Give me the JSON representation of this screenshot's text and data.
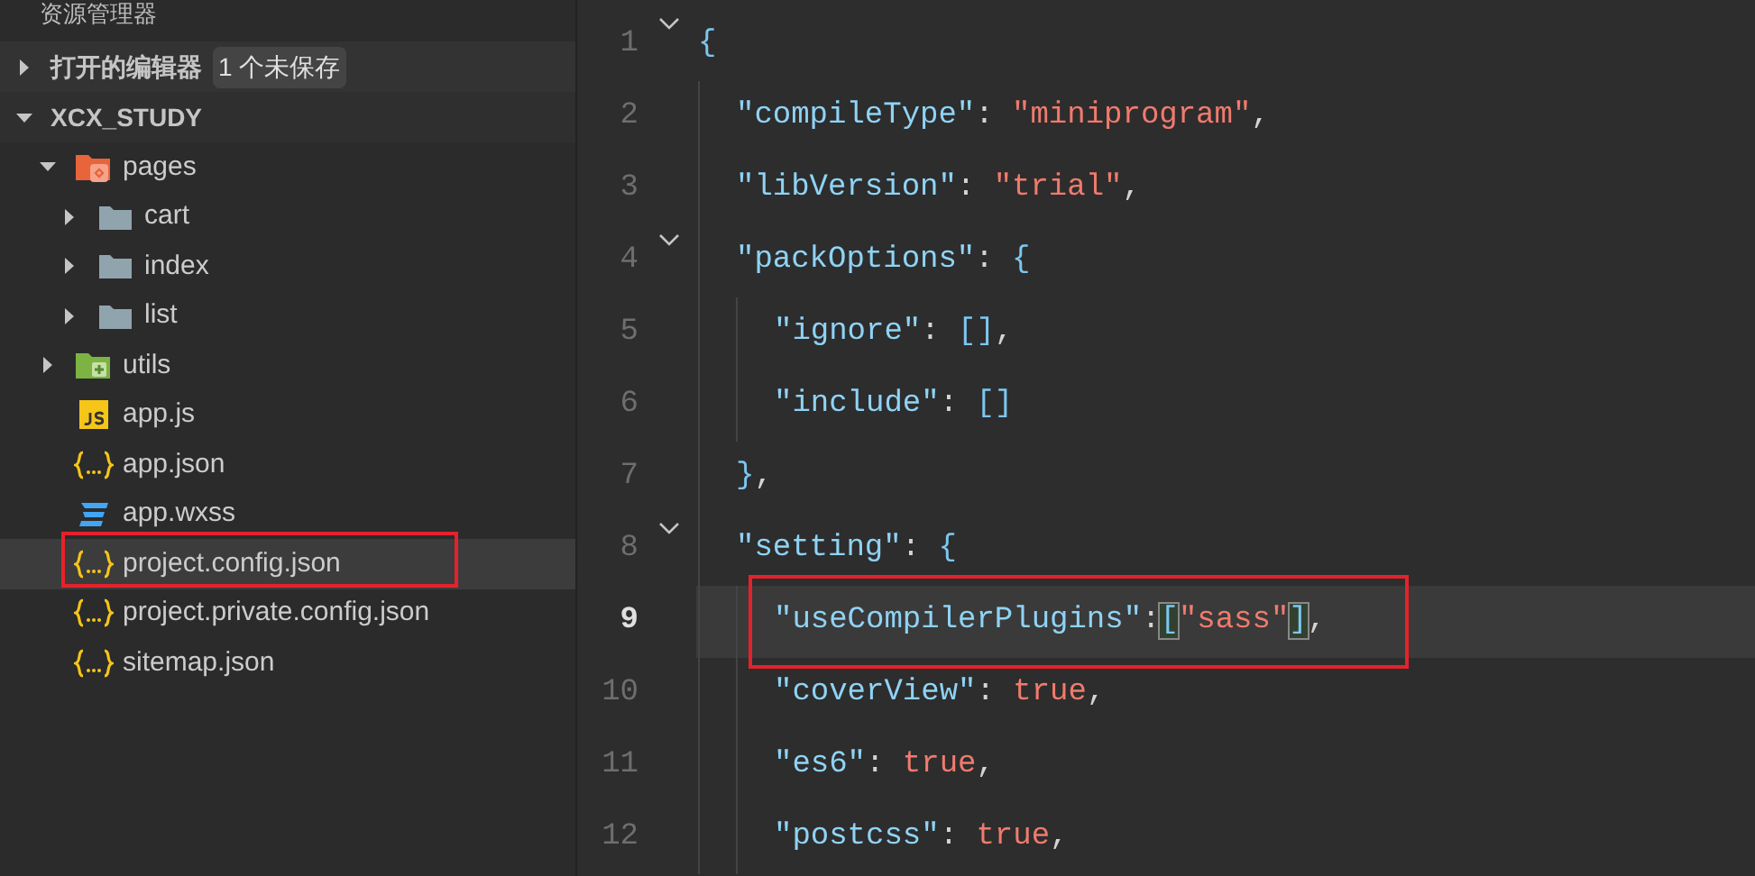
{
  "sidebar": {
    "title": "资源管理器",
    "sections": [
      {
        "label": "打开的编辑器",
        "expanded": false,
        "badge": "1 个未保存"
      },
      {
        "label": "XCX_STUDY",
        "expanded": true,
        "items": [
          {
            "name": "pages",
            "kind": "pages-folder",
            "expanded": true,
            "selected": false,
            "annotated": false,
            "children": [
              {
                "name": "cart",
                "kind": "folder",
                "expanded": false,
                "selected": false,
                "annotated": false
              },
              {
                "name": "index",
                "kind": "folder",
                "expanded": false,
                "selected": false,
                "annotated": false
              },
              {
                "name": "list",
                "kind": "folder",
                "expanded": false,
                "selected": false,
                "annotated": false
              }
            ]
          },
          {
            "name": "utils",
            "kind": "utils-folder",
            "expanded": false,
            "selected": false,
            "annotated": false
          },
          {
            "name": "app.js",
            "kind": "js",
            "selected": false,
            "annotated": false
          },
          {
            "name": "app.json",
            "kind": "json",
            "selected": false,
            "annotated": false
          },
          {
            "name": "app.wxss",
            "kind": "wxss",
            "selected": false,
            "annotated": false
          },
          {
            "name": "project.config.json",
            "kind": "json",
            "selected": true,
            "annotated": true
          },
          {
            "name": "project.private.config.json",
            "kind": "json",
            "selected": false,
            "annotated": false
          },
          {
            "name": "sitemap.json",
            "kind": "json",
            "selected": false,
            "annotated": false
          }
        ]
      }
    ]
  },
  "editor": {
    "lines": [
      {
        "number": "1",
        "foldable": true,
        "current": false,
        "annotated": false,
        "tokens": [
          {
            "text": "{",
            "kind": "brace"
          }
        ],
        "children": [
          {
            "number": "2",
            "foldable": false,
            "current": false,
            "annotated": false,
            "tokens": [
              {
                "text": "\"compileType\"",
                "kind": "key"
              },
              {
                "text": ": ",
                "kind": "punct"
              },
              {
                "text": "\"miniprogram\"",
                "kind": "string"
              },
              {
                "text": ",",
                "kind": "punct"
              }
            ]
          },
          {
            "number": "3",
            "foldable": false,
            "current": false,
            "annotated": false,
            "tokens": [
              {
                "text": "\"libVersion\"",
                "kind": "key"
              },
              {
                "text": ": ",
                "kind": "punct"
              },
              {
                "text": "\"trial\"",
                "kind": "string"
              },
              {
                "text": ",",
                "kind": "punct"
              }
            ]
          },
          {
            "number": "4",
            "foldable": true,
            "current": false,
            "annotated": false,
            "tokens": [
              {
                "text": "\"packOptions\"",
                "kind": "key"
              },
              {
                "text": ": ",
                "kind": "punct"
              },
              {
                "text": "{",
                "kind": "brace"
              }
            ],
            "children": [
              {
                "number": "5",
                "foldable": false,
                "current": false,
                "annotated": false,
                "tokens": [
                  {
                    "text": "\"ignore\"",
                    "kind": "key"
                  },
                  {
                    "text": ": ",
                    "kind": "punct"
                  },
                  {
                    "text": "[]",
                    "kind": "brace"
                  },
                  {
                    "text": ",",
                    "kind": "punct"
                  }
                ]
              },
              {
                "number": "6",
                "foldable": false,
                "current": false,
                "annotated": false,
                "tokens": [
                  {
                    "text": "\"include\"",
                    "kind": "key"
                  },
                  {
                    "text": ": ",
                    "kind": "punct"
                  },
                  {
                    "text": "[]",
                    "kind": "brace"
                  }
                ]
              }
            ]
          },
          {
            "number": "7",
            "foldable": false,
            "current": false,
            "annotated": false,
            "tokens": [
              {
                "text": "}",
                "kind": "brace"
              },
              {
                "text": ",",
                "kind": "punct"
              }
            ]
          },
          {
            "number": "8",
            "foldable": true,
            "current": false,
            "annotated": false,
            "tokens": [
              {
                "text": "\"setting\"",
                "kind": "key"
              },
              {
                "text": ": ",
                "kind": "punct"
              },
              {
                "text": "{",
                "kind": "brace"
              }
            ],
            "children": [
              {
                "number": "9",
                "foldable": false,
                "current": true,
                "annotated": true,
                "tokens": [
                  {
                    "text": "\"useCompilerPlugins\"",
                    "kind": "key"
                  },
                  {
                    "text": ":",
                    "kind": "punct"
                  },
                  {
                    "text": "[",
                    "kind": "matched-bracket"
                  },
                  {
                    "text": "\"sass\"",
                    "kind": "string"
                  },
                  {
                    "text": "]",
                    "kind": "matched-bracket"
                  },
                  {
                    "text": ",",
                    "kind": "punct"
                  }
                ]
              },
              {
                "number": "10",
                "foldable": false,
                "current": false,
                "annotated": false,
                "tokens": [
                  {
                    "text": "\"coverView\"",
                    "kind": "key"
                  },
                  {
                    "text": ": ",
                    "kind": "punct"
                  },
                  {
                    "text": "true",
                    "kind": "literal"
                  },
                  {
                    "text": ",",
                    "kind": "punct"
                  }
                ]
              },
              {
                "number": "11",
                "foldable": false,
                "current": false,
                "annotated": false,
                "tokens": [
                  {
                    "text": "\"es6\"",
                    "kind": "key"
                  },
                  {
                    "text": ": ",
                    "kind": "punct"
                  },
                  {
                    "text": "true",
                    "kind": "literal"
                  },
                  {
                    "text": ",",
                    "kind": "punct"
                  }
                ]
              },
              {
                "number": "12",
                "foldable": false,
                "current": false,
                "annotated": false,
                "tokens": [
                  {
                    "text": "\"postcss\"",
                    "kind": "key"
                  },
                  {
                    "text": ": ",
                    "kind": "punct"
                  },
                  {
                    "text": "true",
                    "kind": "literal"
                  },
                  {
                    "text": ",",
                    "kind": "punct"
                  }
                ]
              }
            ]
          }
        ]
      }
    ]
  }
}
